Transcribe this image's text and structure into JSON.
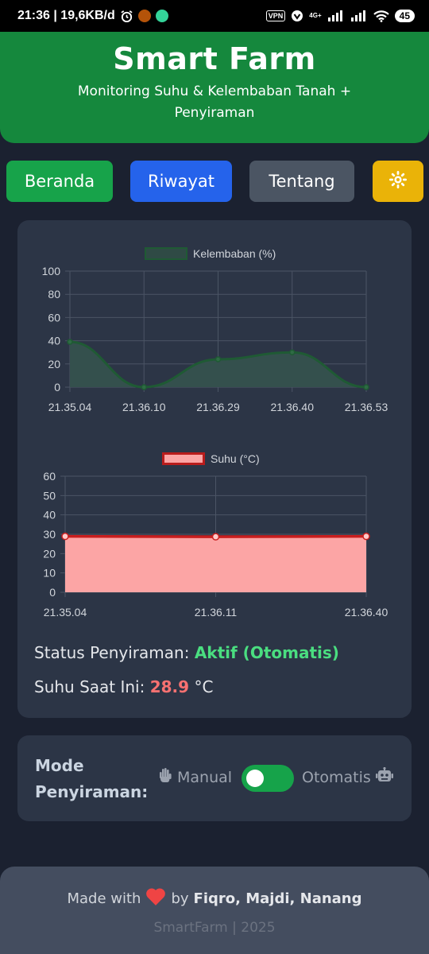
{
  "status_bar": {
    "time_speed": "21:36 | 19,6KB/d",
    "vpn": "VPN",
    "network": "4G+",
    "battery": "45"
  },
  "header": {
    "title": "Smart Farm",
    "subtitle": "Monitoring Suhu & Kelembaban Tanah + Penyiraman"
  },
  "nav": {
    "home": "Beranda",
    "history": "Riwayat",
    "about": "Tentang",
    "theme_icon": "sun-icon"
  },
  "colors": {
    "header": "#15883d",
    "home_btn": "#17a34a",
    "history_btn": "#2563eb",
    "about_btn": "#4b5563",
    "theme_btn": "#eab308",
    "humidity_line": "#1f5a34",
    "temp_line": "#c81e1e",
    "temp_fill": "#fca5a5"
  },
  "chart_data": [
    {
      "type": "area",
      "legend": "Kelembaban (%)",
      "categories": [
        "21.35.04",
        "21.36.10",
        "21.36.29",
        "21.36.40",
        "21.36.53"
      ],
      "values": [
        39,
        0,
        24,
        30,
        0
      ],
      "ylim": [
        0,
        100
      ],
      "yticks": [
        100,
        80,
        60,
        40,
        20,
        0
      ],
      "grid": true,
      "legend_position": "top"
    },
    {
      "type": "area",
      "legend": "Suhu (°C)",
      "categories": [
        "21.35.04",
        "21.36.11",
        "21.36.40"
      ],
      "values": [
        28.9,
        28.7,
        28.9
      ],
      "ylim": [
        0,
        60
      ],
      "yticks": [
        60,
        50,
        40,
        30,
        20,
        10,
        0
      ],
      "grid": true,
      "legend_position": "top"
    }
  ],
  "status": {
    "watering_label": "Status Penyiraman:",
    "watering_value": "Aktif (Otomatis)",
    "temp_label": "Suhu Saat Ini:",
    "temp_value": "28.9",
    "temp_unit": "°C"
  },
  "mode": {
    "title_line1": "Mode",
    "title_line2": "Penyiraman:",
    "manual": "Manual",
    "auto": "Otomatis",
    "toggle_on": true
  },
  "footer": {
    "made_with": "Made with",
    "by": "by",
    "authors": "Fiqro, Majdi, Nanang",
    "copyright": "SmartFarm | 2025"
  }
}
